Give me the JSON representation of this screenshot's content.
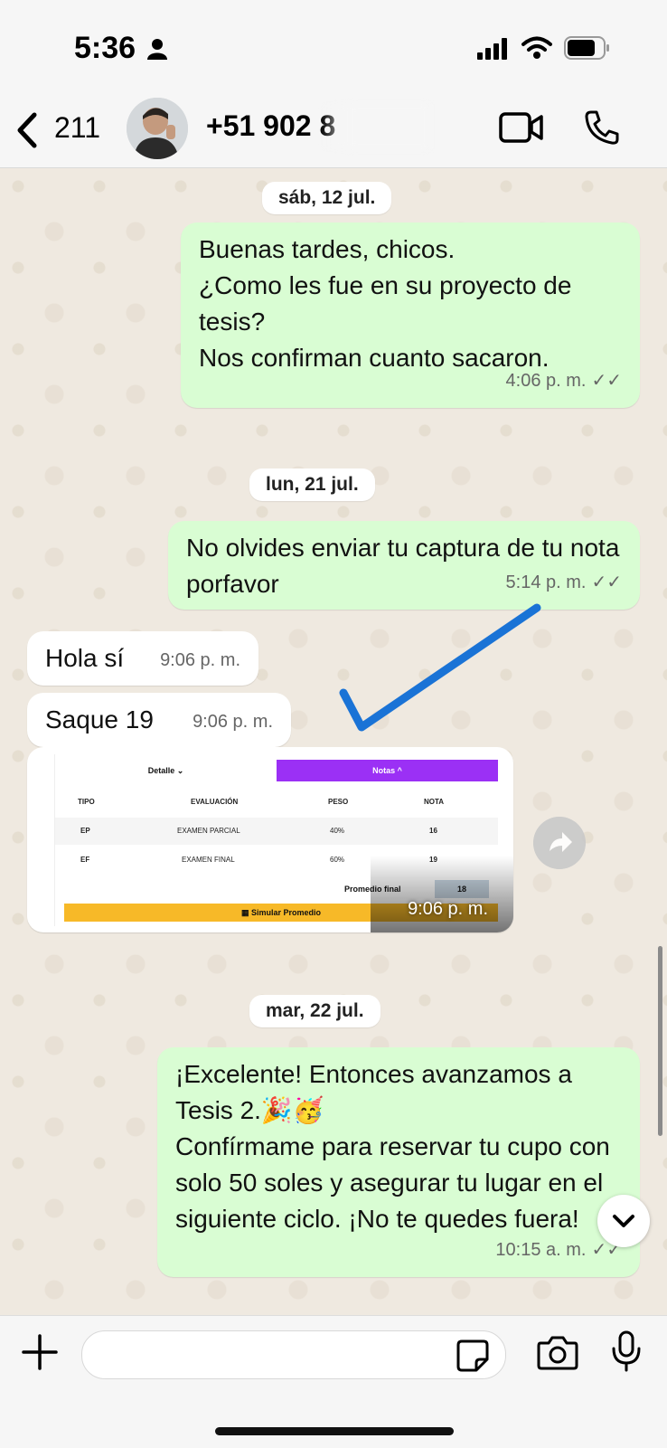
{
  "status_bar": {
    "time": "5:36"
  },
  "header": {
    "back_count": "211",
    "contact_name": "+51 902 8"
  },
  "dates": [
    "sáb, 12 jul.",
    "lun, 21 jul.",
    "mar, 22 jul."
  ],
  "messages": [
    {
      "text": "Buenas tardes, chicos.\n¿Como les fue en su proyecto de tesis?\nNos confirman cuanto sacaron.",
      "time": "4:06 p. m."
    },
    {
      "text": "No olvides enviar tu captura de tu nota porfavor",
      "time": "5:14 p. m."
    },
    {
      "text": "Hola sí",
      "time": "9:06 p. m."
    },
    {
      "text": "Saque 19",
      "time": "9:06 p. m."
    },
    {
      "text": "¡Excelente! Entonces avanzamos a Tesis 2.🎉🥳\nConfírmame para reservar tu cupo con solo 50 soles y asegurar tu lugar en el siguiente ciclo. ¡No te quedes fuera!",
      "time": "10:15 a. m."
    }
  ],
  "image_message": {
    "time": "9:06 p. m.",
    "tab_detalle": "Detalle",
    "tab_notas": "Notas",
    "headers": {
      "tipo": "TIPO",
      "evaluacion": "EVALUACIÓN",
      "peso": "PESO",
      "nota": "NOTA"
    },
    "rows": [
      {
        "tipo": "EP",
        "evaluacion": "EXAMEN PARCIAL",
        "peso": "40%",
        "nota": "16"
      },
      {
        "tipo": "EF",
        "evaluacion": "EXAMEN FINAL",
        "peso": "60%",
        "nota": "19"
      }
    ],
    "promedio_label": "Promedio final",
    "promedio_value": "18",
    "simular_label": "Simular Promedio"
  },
  "icons": [
    "person-icon",
    "signal-icon",
    "wifi-icon",
    "battery-icon",
    "back-chevron-icon",
    "video-call-icon",
    "phone-icon",
    "forward-icon",
    "chevron-down-icon",
    "plus-icon",
    "sticker-icon",
    "camera-icon",
    "microphone-icon",
    "double-check-icon"
  ],
  "colors": {
    "outgoing_bubble": "#d9fdd3",
    "incoming_bubble": "#ffffff",
    "chat_bg": "#efe9e0",
    "check_annotation": "#1a73d6",
    "notas_tab": "#9b30f5",
    "simular_bar": "#f7b928"
  }
}
